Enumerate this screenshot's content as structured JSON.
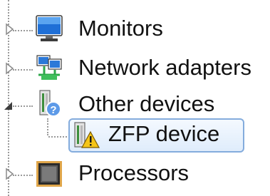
{
  "tree": {
    "items": [
      {
        "label": "Monitors",
        "expander": "collapsed",
        "icon": "monitor-icon",
        "level": 0
      },
      {
        "label": "Network adapters",
        "expander": "collapsed",
        "icon": "network-adapter-icon",
        "level": 0
      },
      {
        "label": "Other devices",
        "expander": "expanded",
        "icon": "unknown-device-icon",
        "level": 0
      },
      {
        "label": "ZFP device",
        "expander": "none",
        "icon": "warning-device-icon",
        "level": 1,
        "selected": true
      },
      {
        "label": "Processors",
        "expander": "collapsed",
        "icon": "processor-icon",
        "level": 0
      }
    ]
  },
  "colors": {
    "selection_border": "#84acdd",
    "selection_fill": "#dfecfb",
    "warning": "#f5c518",
    "monitor_blue": "#1f6fd6"
  }
}
